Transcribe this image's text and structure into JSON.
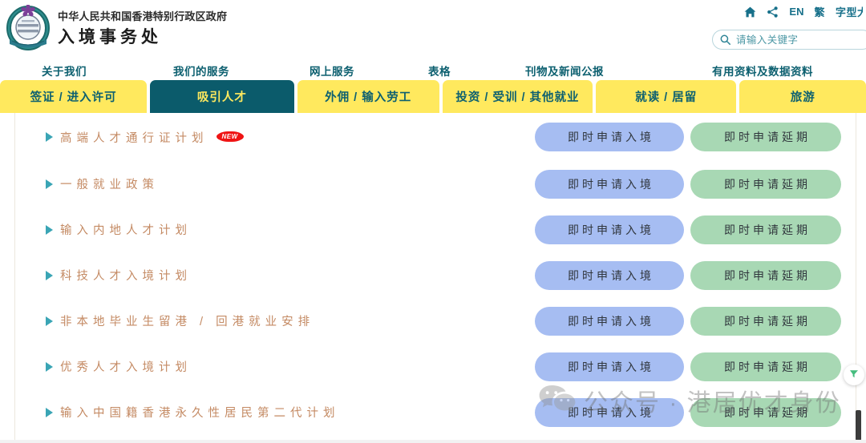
{
  "header": {
    "gov_line": "中华人民共和国香港特别行政区政府",
    "dept_line": "入境事务处",
    "logo_name": "hk-immigration-crest",
    "utility": {
      "home_icon": "home-icon",
      "share_icon": "share-icon",
      "lang_en": "EN",
      "lang_tc": "繁",
      "font_size_label": "字型大小"
    },
    "search": {
      "icon": "search-icon",
      "placeholder": "请输入关键字",
      "value": ""
    }
  },
  "mainnav": {
    "items": [
      {
        "label": "关于我们"
      },
      {
        "label": "我们的服务"
      },
      {
        "label": "网上服务"
      },
      {
        "label": "表格"
      },
      {
        "label": "刊物及新闻公报"
      },
      {
        "label": "有用资料及数据资料"
      }
    ]
  },
  "tabbar": {
    "active_index": 1,
    "tabs": [
      {
        "label": "签证 / 进入许可"
      },
      {
        "label": "吸引人才"
      },
      {
        "label": "外佣 / 输入劳工"
      },
      {
        "label": "投资 / 受训 / 其他就业"
      },
      {
        "label": "就读 / 居留"
      },
      {
        "label": "旅游"
      }
    ]
  },
  "content": {
    "button_entry_label": "即时申请入境",
    "button_extend_label": "即时申请延期",
    "new_badge_label": "NEW",
    "rows": [
      {
        "label": "高端人才通行证计划",
        "new": true
      },
      {
        "label": "一般就业政策",
        "new": false
      },
      {
        "label": "输入内地人才计划",
        "new": false
      },
      {
        "label": "科技人才入境计划",
        "new": false
      },
      {
        "label": "非本地毕业生留港 / 回港就业安排",
        "new": false
      },
      {
        "label": "优秀人才入境计划",
        "new": false
      },
      {
        "label": "输入中国籍香港永久性居民第二代计划",
        "new": false
      }
    ]
  },
  "watermark": {
    "icon": "wechat-icon",
    "text": "公众号 · 港居优才身份"
  },
  "float": {
    "icon": "scroll-up-icon"
  },
  "colors": {
    "tab_yellow": "#ffe95e",
    "tab_active_teal": "#0b5b6b",
    "nav_teal": "#0d6070",
    "link_orange": "#c48a63",
    "caret_teal": "#3aa5b5",
    "btn_entry_blue": "#a6bdf2",
    "btn_extend_green": "#a8d8b4",
    "badge_red": "#ef1414"
  }
}
